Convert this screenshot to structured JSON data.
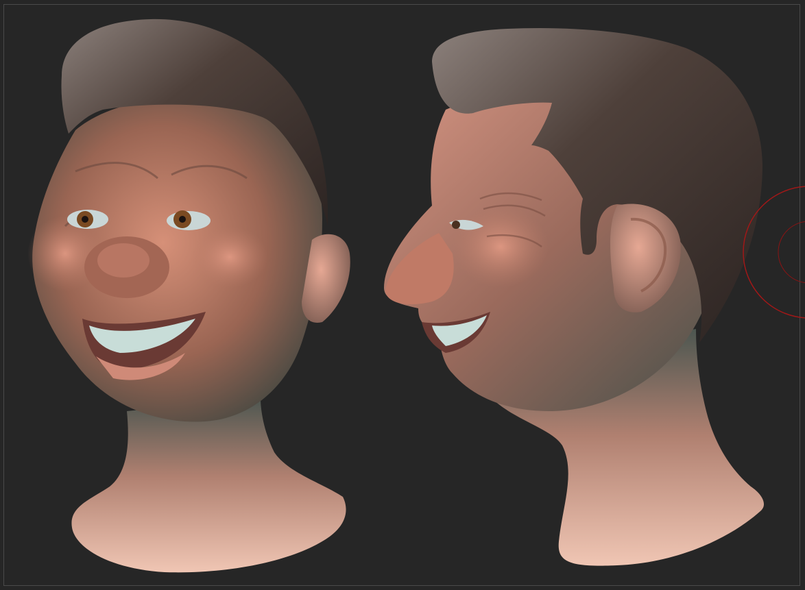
{
  "app": {
    "canvas_background": "#262626",
    "frame_border": "#4a4a4a"
  },
  "viewport": {
    "models": [
      {
        "name": "head-front-three-quarter-view"
      },
      {
        "name": "head-side-profile-view"
      }
    ],
    "brush_cursor": {
      "icon": "brush-circle-icon",
      "color": "#a01818"
    }
  },
  "colors": {
    "skin": "#c27a62",
    "skin_shadow": "#4a4a3e",
    "hair": "#4a3c36",
    "hair_highlight": "#8a7e7a",
    "neck_light": "#e8b8a6",
    "teeth": "#c8ddd8",
    "iris": "#7a4a22"
  }
}
